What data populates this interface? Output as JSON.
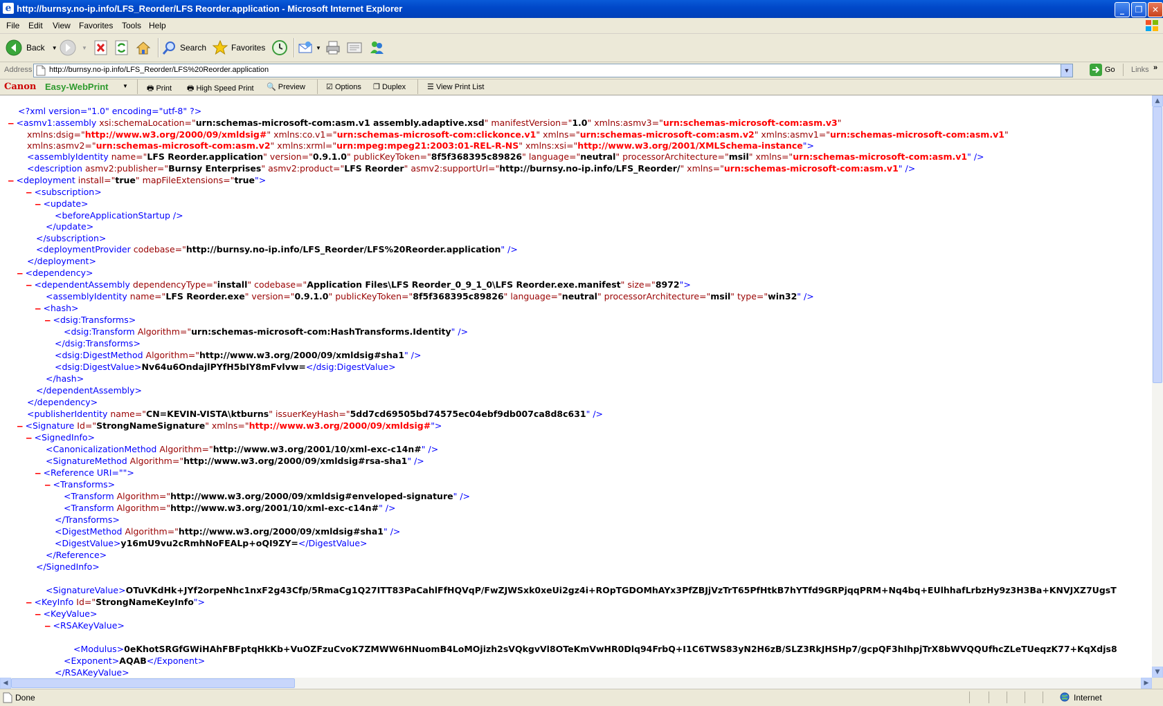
{
  "window": {
    "title": "http://burnsy.no-ip.info/LFS_Reorder/LFS Reorder.application - Microsoft Internet Explorer",
    "icon": "ie-page-icon"
  },
  "menu": [
    "File",
    "Edit",
    "View",
    "Favorites",
    "Tools",
    "Help"
  ],
  "toolbar": {
    "back": "Back",
    "search": "Search",
    "favorites": "Favorites"
  },
  "address": {
    "label": "Address",
    "url": "http://burnsy.no-ip.info/LFS_Reorder/LFS%20Reorder.application",
    "go": "Go",
    "links": "Links"
  },
  "canon": {
    "brand": "Canon",
    "product": "Easy-WebPrint",
    "print": "Print",
    "high_speed": "High Speed Print",
    "preview": "Preview",
    "options": "Options",
    "duplex": "Duplex",
    "view_list": "View Print List"
  },
  "xml": {
    "l0": {
      "text": "<?xml version=\"1.0\" encoding=\"utf-8\" ?>"
    },
    "l1": {
      "m": "–",
      "a": "<asmv1:assembly",
      "b": " xsi:schemaLocation=\"",
      "c": "urn:schemas-microsoft-com:asm.v1 assembly.adaptive.xsd",
      "d": "\" manifestVersion=\"",
      "e": "1.0",
      "f": "\" xmlns:asmv3=\"",
      "g": "urn:schemas-microsoft-com:asm.v3",
      "h": "\""
    },
    "l2": {
      "a": "xmlns:dsig=\"",
      "b": "http://www.w3.org/2000/09/xmldsig#",
      "c": "\" xmlns:co.v1=\"",
      "d": "urn:schemas-microsoft-com:clickonce.v1",
      "e": "\" xmlns=\"",
      "f": "urn:schemas-microsoft-com:asm.v2",
      "g": "\" xmlns:asmv1=\"",
      "h": "urn:schemas-microsoft-com:asm.v1",
      "i": "\""
    },
    "l3": {
      "a": "xmlns:asmv2=\"",
      "b": "urn:schemas-microsoft-com:asm.v2",
      "c": "\" xmlns:xrml=\"",
      "d": "urn:mpeg:mpeg21:2003:01-REL-R-NS",
      "e": "\" xmlns:xsi=\"",
      "f": "http://www.w3.org/2001/XMLSchema-instance",
      "g": "\">"
    },
    "l4": {
      "a": "<assemblyIdentity",
      "b": " name=\"",
      "c": "LFS Reorder.application",
      "d": "\" version=\"",
      "e": "0.9.1.0",
      "f": "\" publicKeyToken=\"",
      "g": "8f5f368395c89826",
      "h": "\" language=\"",
      "i": "neutral",
      "j": "\" processorArchitecture=\"",
      "k": "msil",
      "l": "\" xmlns=\"",
      "n": "urn:schemas-microsoft-com:asm.v1",
      "o": "\" />"
    },
    "l5": {
      "a": "<description",
      "b": " asmv2:publisher=\"",
      "c": "Burnsy Enterprises",
      "d": "\" asmv2:product=\"",
      "e": "LFS Reorder",
      "f": "\" asmv2:supportUrl=\"",
      "g": "http://burnsy.no-ip.info/LFS_Reorder/",
      "h": "\" xmlns=\"",
      "i": "urn:schemas-microsoft-com:asm.v1",
      "j": "\" />"
    },
    "l6": {
      "m": "–",
      "a": "<deployment",
      "b": " install=\"",
      "c": "true",
      "d": "\" mapFileExtensions=\"",
      "e": "true",
      "f": "\">"
    },
    "l7": {
      "m": "–",
      "a": "<subscription>"
    },
    "l8": {
      "m": "–",
      "a": "<update>"
    },
    "l9": {
      "a": "<beforeApplicationStartup />"
    },
    "l10": {
      "a": "</update>"
    },
    "l11": {
      "a": "</subscription>"
    },
    "l12": {
      "a": "<deploymentProvider",
      "b": " codebase=\"",
      "c": "http://burnsy.no-ip.info/LFS_Reorder/LFS%20Reorder.application",
      "d": "\" />"
    },
    "l13": {
      "a": "</deployment>"
    },
    "l14": {
      "m": "–",
      "a": "<dependency>"
    },
    "l15": {
      "m": "–",
      "a": "<dependentAssembly",
      "b": " dependencyType=\"",
      "c": "install",
      "d": "\" codebase=\"",
      "e": "Application Files\\LFS Reorder_0_9_1_0\\LFS Reorder.exe.manifest",
      "f": "\" size=\"",
      "g": "8972",
      "h": "\">"
    },
    "l16": {
      "a": "<assemblyIdentity",
      "b": " name=\"",
      "c": "LFS Reorder.exe",
      "d": "\" version=\"",
      "e": "0.9.1.0",
      "f": "\" publicKeyToken=\"",
      "g": "8f5f368395c89826",
      "h": "\" language=\"",
      "i": "neutral",
      "j": "\" processorArchitecture=\"",
      "k": "msil",
      "l": "\" type=\"",
      "n": "win32",
      "o": "\" />"
    },
    "l17": {
      "m": "–",
      "a": "<hash>"
    },
    "l18": {
      "m": "–",
      "a": "<dsig:Transforms>"
    },
    "l19": {
      "a": "<dsig:Transform",
      "b": " Algorithm=\"",
      "c": "urn:schemas-microsoft-com:HashTransforms.Identity",
      "d": "\" />"
    },
    "l20": {
      "a": "</dsig:Transforms>"
    },
    "l21": {
      "a": "<dsig:DigestMethod",
      "b": " Algorithm=\"",
      "c": "http://www.w3.org/2000/09/xmldsig#sha1",
      "d": "\" />"
    },
    "l22": {
      "a": "<dsig:DigestValue>",
      "b": "Nv64u6OndajlPYfH5bIY8mFvlvw=",
      "c": "</dsig:DigestValue>"
    },
    "l23": {
      "a": "</hash>"
    },
    "l24": {
      "a": "</dependentAssembly>"
    },
    "l25": {
      "a": "</dependency>"
    },
    "l26": {
      "a": "<publisherIdentity",
      "b": " name=\"",
      "c": "CN=KEVIN-VISTA\\ktburns",
      "d": "\" issuerKeyHash=\"",
      "e": "5dd7cd69505bd74575ec04ebf9db007ca8d8c631",
      "f": "\" />"
    },
    "l27": {
      "m": "–",
      "a": "<Signature",
      "b": " Id=\"",
      "c": "StrongNameSignature",
      "d": "\" xmlns=\"",
      "e": "http://www.w3.org/2000/09/xmldsig#",
      "f": "\">"
    },
    "l28": {
      "m": "–",
      "a": "<SignedInfo>"
    },
    "l29": {
      "a": "<CanonicalizationMethod",
      "b": " Algorithm=\"",
      "c": "http://www.w3.org/2001/10/xml-exc-c14n#",
      "d": "\" />"
    },
    "l30": {
      "a": "<SignatureMethod",
      "b": " Algorithm=\"",
      "c": "http://www.w3.org/2000/09/xmldsig#rsa-sha1",
      "d": "\" />"
    },
    "l31": {
      "m": "–",
      "a": "<Reference",
      "b": " URI=\"\">"
    },
    "l32": {
      "m": "–",
      "a": "<Transforms>"
    },
    "l33": {
      "a": "<Transform",
      "b": " Algorithm=\"",
      "c": "http://www.w3.org/2000/09/xmldsig#enveloped-signature",
      "d": "\" />"
    },
    "l34": {
      "a": "<Transform",
      "b": " Algorithm=\"",
      "c": "http://www.w3.org/2001/10/xml-exc-c14n#",
      "d": "\" />"
    },
    "l35": {
      "a": "</Transforms>"
    },
    "l36": {
      "a": "<DigestMethod",
      "b": " Algorithm=\"",
      "c": "http://www.w3.org/2000/09/xmldsig#sha1",
      "d": "\" />"
    },
    "l37": {
      "a": "<DigestValue>",
      "b": "y16mU9vu2cRmhNoFEALp+oQI9ZY=",
      "c": "</DigestValue>"
    },
    "l38": {
      "a": "</Reference>"
    },
    "l39": {
      "a": "</SignedInfo>"
    },
    "l40": {
      "a": "<SignatureValue>",
      "b": "OTuVKdHk+JYf2orpeNhc1nxF2g43Cfp/5RmaCg1Q27ITT83PaCahlFfHQVqP/FwZJWSxk0xeUi2gz4i+ROpTGDOMhAYx3PfZBJjVzTrT65PfHtkB7hYTfd9GRPjqqPRM+Nq4bq+EUlhhafLrbzHy9z3H3Ba+KNVJXZ7UgsT"
    },
    "l41": {
      "m": "–",
      "a": "<KeyInfo",
      "b": " Id=\"",
      "c": "StrongNameKeyInfo",
      "d": "\">"
    },
    "l42": {
      "m": "–",
      "a": "<KeyValue>"
    },
    "l43": {
      "m": "–",
      "a": "<RSAKeyValue>"
    },
    "l44": {
      "a": "<Modulus>",
      "b": "0eKhotSRGfGWiHAhFBFptqHkKb+VuOZFzuCvoK7ZMWW6HNuomB4LoMOjizh2sVQkgvVl8OTeKmVwHR0Dlq94FrbQ+I1C6TWS83yN2H6zB/SLZ3RkJHSHp7/gcpQF3hIhpjTrX8bWVQQUfhcZLeTUeqzK77+KqXdjs8"
    },
    "l45": {
      "a": "<Exponent>",
      "b": "AQAB",
      "c": "</Exponent>"
    },
    "l46": {
      "a": "</RSAKeyValue>"
    }
  },
  "status": {
    "text": "Done",
    "zone": "Internet"
  }
}
